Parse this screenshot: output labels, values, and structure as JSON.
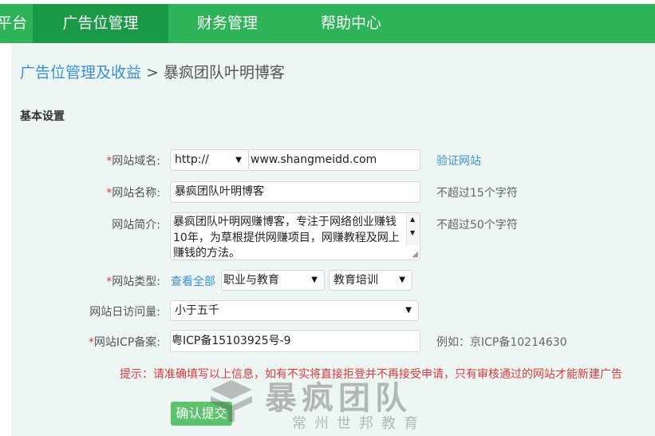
{
  "nav": {
    "brand": "平台",
    "items": [
      "广告位管理",
      "财务管理",
      "帮助中心"
    ]
  },
  "breadcrumb": {
    "parent": "广告位管理及收益",
    "separator": ">",
    "current": "暴疯团队叶明博客"
  },
  "section_title": "基本设置",
  "form": {
    "domain": {
      "required": "*",
      "label": "网站域名:",
      "protocol": "http://",
      "value": "www.shangmeidd.com",
      "verify_link": "验证网站"
    },
    "name": {
      "required": "*",
      "label": "网站名称:",
      "value": "暴疯团队叶明博客",
      "hint": "不超过15个字符"
    },
    "intro": {
      "label": "网站简介:",
      "value": "暴疯团队叶明网赚博客，专注于网络创业赚钱10年，为草根提供网赚项目，网赚教程及网上赚钱的方法。",
      "hint": "不超过50个字符"
    },
    "type": {
      "required": "*",
      "label": "网站类型:",
      "view_all": "查看全部",
      "category": "职业与教育",
      "subcategory": "教育培训"
    },
    "traffic": {
      "label": "网站日访问量:",
      "value": "小于五千"
    },
    "icp": {
      "required": "*",
      "label": "网站ICP备案:",
      "value": "粤ICP备15103925号-9",
      "hint": "例如：京ICP备10214630"
    }
  },
  "notice": "提示：请准确填写以上信息，如有不实将直接拒登并不再接受申请，只有审核通过的网站才能新建广告",
  "submit_label": "确认提交",
  "watermark": {
    "main": "暴疯团队",
    "sub": "常州世邦教育"
  },
  "colors": {
    "nav": "#2eb358",
    "nav_active": "#1a9a47",
    "link": "#3b8fd9",
    "required": "#e0393e",
    "submit": "#5cc26c",
    "panel": "#edf6f3"
  }
}
